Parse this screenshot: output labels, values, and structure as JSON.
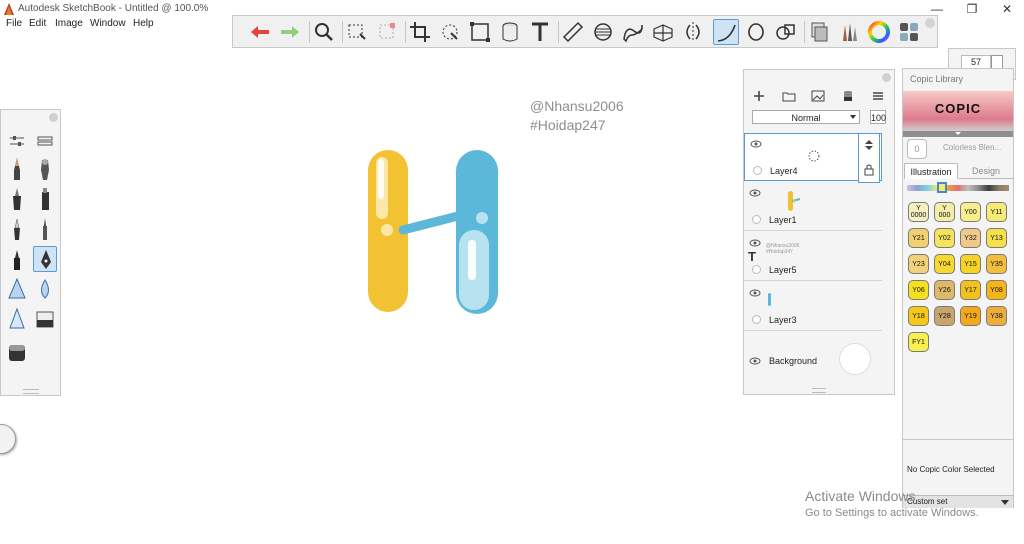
{
  "window": {
    "title": "Autodesk SketchBook - Untitled @ 100.0%",
    "minimize": "—",
    "maximize": "❐",
    "close": "✕"
  },
  "menu": [
    "File",
    "Edit",
    "Image",
    "Window",
    "Help"
  ],
  "toolbar": {
    "tools": [
      "undo-icon",
      "redo-icon",
      "zoom-icon",
      "lasso-select-icon",
      "magic-wand-icon",
      "crop-icon",
      "transform-icon",
      "distort-icon",
      "fill-icon",
      "text-icon",
      "ruler-icon",
      "ellipse-guide-icon",
      "french-curve-icon",
      "perspective-icon",
      "symmetry-icon",
      "stroke-icon",
      "ellipse-icon",
      "shape-icon",
      "copy-icon",
      "brushes-icon",
      "color-wheel-icon",
      "palette-icon"
    ],
    "active_tool": "stroke-icon"
  },
  "canvas": {
    "watermark_line1": "@Nhansu2006",
    "watermark_line2": "#Hoidap247",
    "colors": {
      "yellow": "#f2c233",
      "blue": "#5cb8d8",
      "white": "#ffffff"
    }
  },
  "layers": {
    "blend_mode": "Normal",
    "opacity": "100",
    "items": [
      {
        "name": "Layer4",
        "selected": true
      },
      {
        "name": "Layer1",
        "selected": false
      },
      {
        "name": "Layer5",
        "selected": false,
        "text_layer": true,
        "thumb_text": "@Nhansu2006 #Hoidap247"
      },
      {
        "name": "Layer3",
        "selected": false
      },
      {
        "name": "Background",
        "selected": false
      }
    ]
  },
  "brush_size": {
    "value": "57"
  },
  "copic": {
    "title": "Copic Library",
    "logo": "COPIC",
    "selected_label": "Colorless Blen...",
    "selected_swatch": "0",
    "tabs": [
      "Illustration",
      "Design"
    ],
    "active_tab": "Illustration",
    "chips": [
      {
        "code": "Y\n0000",
        "color": "#f4f0c2"
      },
      {
        "code": "Y\n000",
        "color": "#f5eea8"
      },
      {
        "code": "Y00",
        "color": "#f8ee8e"
      },
      {
        "code": "Y11",
        "color": "#f6ea76"
      },
      {
        "code": "Y21",
        "color": "#f2cf70"
      },
      {
        "code": "Y02",
        "color": "#f6e35c"
      },
      {
        "code": "Y32",
        "color": "#f0c98a"
      },
      {
        "code": "Y13",
        "color": "#f6e14a"
      },
      {
        "code": "Y23",
        "color": "#f0d27a"
      },
      {
        "code": "Y04",
        "color": "#f5d932"
      },
      {
        "code": "Y15",
        "color": "#f7d228"
      },
      {
        "code": "Y35",
        "color": "#f2be3c"
      },
      {
        "code": "Y06",
        "color": "#f7e01e"
      },
      {
        "code": "Y26",
        "color": "#dfb96a"
      },
      {
        "code": "Y17",
        "color": "#f3c11e"
      },
      {
        "code": "Y08",
        "color": "#f5b519"
      },
      {
        "code": "Y18",
        "color": "#f6c818"
      },
      {
        "code": "Y28",
        "color": "#c9a56e"
      },
      {
        "code": "Y19",
        "color": "#f4a91a"
      },
      {
        "code": "Y38",
        "color": "#eeae3c"
      },
      {
        "code": "FY1",
        "color": "#f8f050"
      }
    ],
    "status": "No Copic Color Selected",
    "footer": "Custom set"
  },
  "os_notice": {
    "line1": "Activate Windows",
    "line2": "Go to Settings to activate Windows."
  }
}
